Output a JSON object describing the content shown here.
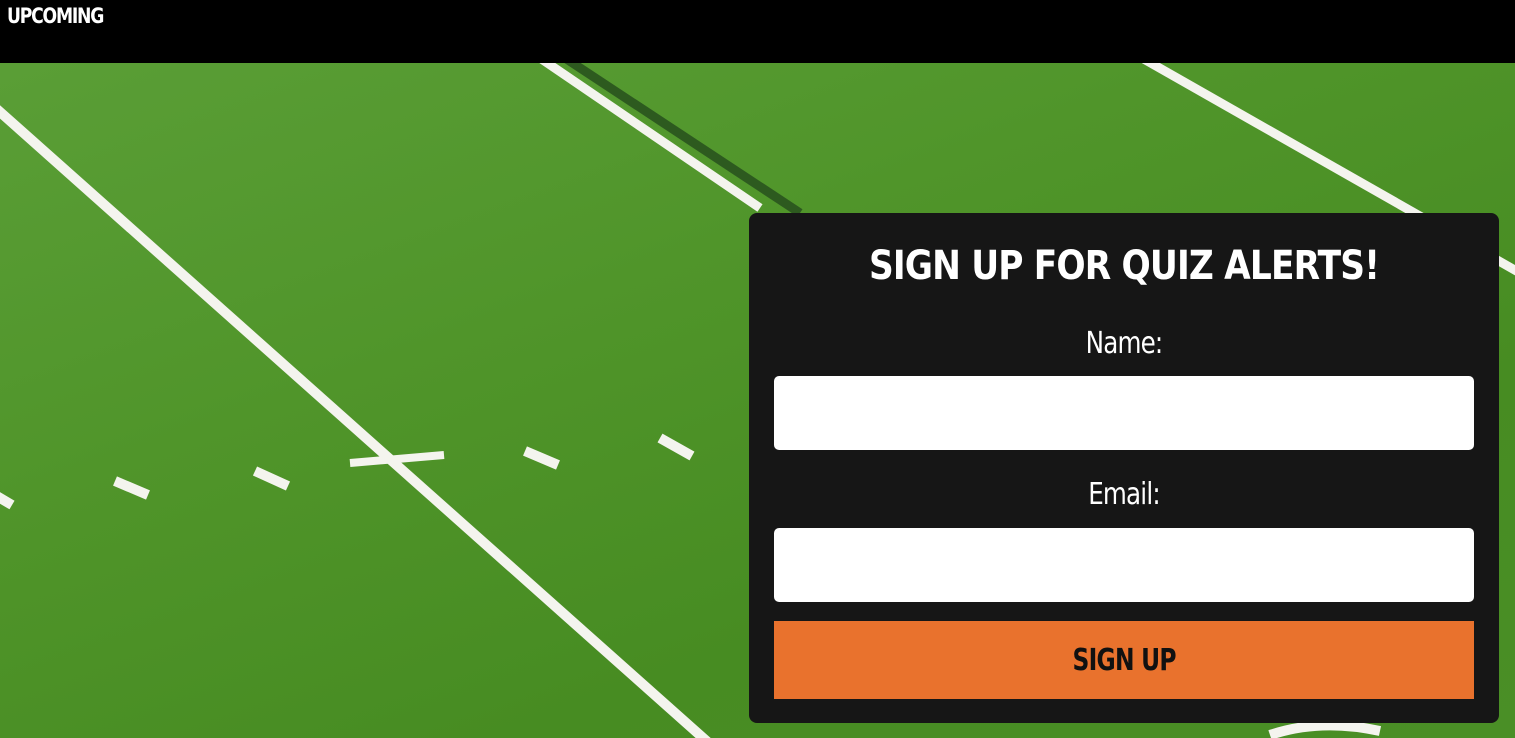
{
  "nav": {
    "upcoming_label": "UPCOMING"
  },
  "signup": {
    "title": "SIGN UP FOR QUIZ ALERTS!",
    "name_label": "Name:",
    "name_value": "",
    "email_label": "Email:",
    "email_value": "",
    "submit_label": "SIGN UP"
  },
  "colors": {
    "topbar": "#000000",
    "card": "#161616",
    "button": "#e9722d",
    "field": "#4f9429"
  }
}
